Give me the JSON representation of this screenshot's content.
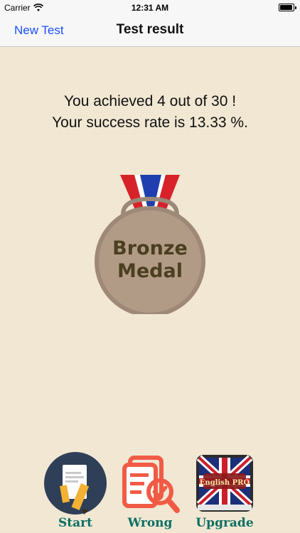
{
  "status_bar": {
    "carrier": "Carrier",
    "time": "12:31 AM"
  },
  "nav": {
    "back_label": "New Test",
    "title": "Test result"
  },
  "result": {
    "line1": "You achieved 4 out of 30 !",
    "line2": "Your success rate is 13.33 %."
  },
  "medal": {
    "line1": "Bronze",
    "line2": "Medal"
  },
  "bottom_actions": [
    {
      "label": "Start",
      "icon": "document-pencil-icon"
    },
    {
      "label": "Wrong",
      "icon": "document-search-icon"
    },
    {
      "label": "Upgrade",
      "icon": "book-uk-flag-icon",
      "book_text": "English PRO"
    }
  ],
  "colors": {
    "accent_link": "#1a4fff",
    "label_teal": "#0b6f63",
    "medal_bronze": "#b29b86"
  }
}
